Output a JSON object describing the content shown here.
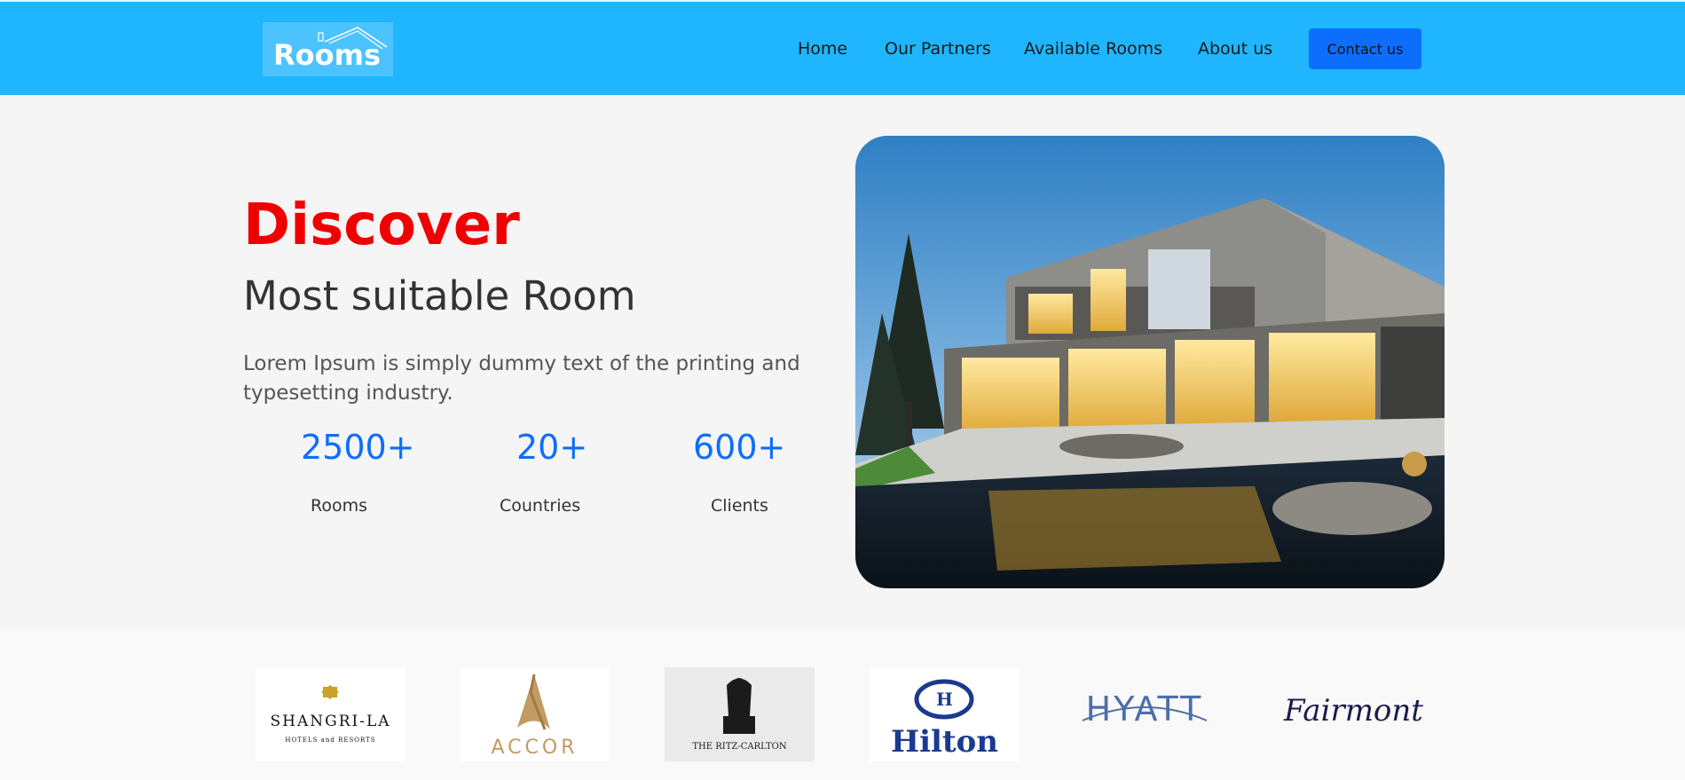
{
  "header": {
    "logo_text": "Rooms",
    "nav": [
      {
        "label": "Home"
      },
      {
        "label": "Our Partners"
      },
      {
        "label": "Available Rooms"
      },
      {
        "label": "About us"
      }
    ],
    "contact_label": "Contact us",
    "background": "#1fb6ff",
    "contact_color": "#0d6efd"
  },
  "hero": {
    "title": "Discover",
    "subtitle": "Most suitable Room",
    "description": "Lorem Ipsum is simply dummy text of the printing and typesetting industry.",
    "title_color": "#f00000",
    "stats": [
      {
        "value": "2500+",
        "label": "Rooms"
      },
      {
        "value": "20+",
        "label": "Countries"
      },
      {
        "value": "600+",
        "label": "Clients"
      }
    ],
    "stat_color": "#0d6efd"
  },
  "partners": [
    {
      "name": "SHANGRI-LA",
      "tagline": "HOTELS and RESORTS"
    },
    {
      "name": "ACCOR"
    },
    {
      "name": "THE RITZ-CARLTON"
    },
    {
      "name": "Hilton"
    },
    {
      "name": "HYATT"
    },
    {
      "name": "Fairmont"
    }
  ]
}
